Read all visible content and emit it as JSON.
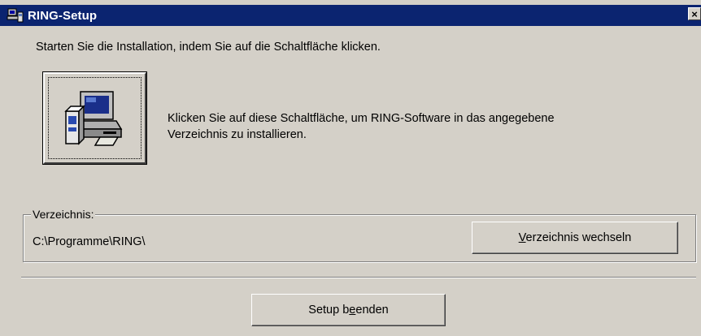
{
  "window": {
    "title": "RING-Setup",
    "close_glyph": "×"
  },
  "main": {
    "instruction": "Starten Sie die Installation, indem Sie auf die Schaltfläche klicken.",
    "install_button_icon": "computer-setup-icon",
    "install_description_line1": "Klicken Sie auf diese Schaltfläche, um RING-Software in das angegebene",
    "install_description_line2": "Verzeichnis zu installieren."
  },
  "directory": {
    "label": "Verzeichnis:",
    "path": "C:\\Programme\\RING\\",
    "change_button": {
      "mnemonic": "V",
      "rest": "erzeichnis wechseln"
    }
  },
  "footer": {
    "exit_button": {
      "before": "Setup b",
      "mnemonic": "e",
      "after": "enden"
    }
  },
  "colors": {
    "titlebar": "#0b2470",
    "face": "#d4d0c8"
  }
}
